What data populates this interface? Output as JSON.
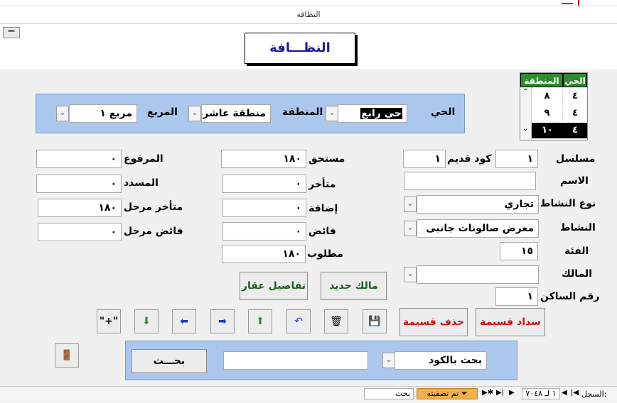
{
  "window": {
    "title": "النظافة"
  },
  "form": {
    "title": "النظـــافة"
  },
  "filter": {
    "hay_label": "الحي",
    "hay_value": "حي رابع",
    "region_label": "المنطقة",
    "region_value": "منطقة عاشرة",
    "block_label": "المربع",
    "block_value": "مربع ١"
  },
  "mini_list": {
    "headers": [
      "الحي",
      "المنطقة"
    ],
    "rows": [
      {
        "hay": "٤",
        "region": "٨"
      },
      {
        "hay": "٤",
        "region": "٩"
      },
      {
        "hay": "٤",
        "region": "١٠"
      }
    ]
  },
  "record": {
    "serial_label": "مسلسل",
    "serial_value": "١",
    "old_code_label": "كود قديم",
    "old_code_value": "١",
    "name_label": "الاسم",
    "name_value": "",
    "activity_type_label": "نوع النشاط",
    "activity_type_value": "تجاري",
    "activity_label": "النشاط",
    "activity_value": "معرض صالونات جانبى",
    "category_label": "الفئة",
    "category_value": "١٥",
    "owner_label": "المالك",
    "owner_value": "",
    "tenant_no_label": "رقم الساكن",
    "tenant_no_value": "١"
  },
  "amounts": {
    "due_label": "مستحق",
    "due_value": "١٨٠",
    "late_label": "متأخر",
    "late_value": "٠",
    "addition_label": "إضافة",
    "addition_value": "٠",
    "surplus_label": "فائض",
    "surplus_value": "٠",
    "required_label": "مطلوب",
    "required_value": "١٨٠",
    "raised_label": "المرفوع",
    "raised_value": "٠",
    "paid_label": "المسدد",
    "paid_value": "٠",
    "carried_late_label": "متأخر مرحل",
    "carried_late_value": "١٨٠",
    "carried_surplus_label": "فائض مرحل",
    "carried_surplus_value": "٠"
  },
  "buttons": {
    "new_owner": "مالك جديد",
    "property_details": "تفاصيل عقار",
    "pay_voucher": "سداد قسيمة",
    "delete_voucher": "حذف قسيمة",
    "search": "بحـــث",
    "add_record": "\"+\""
  },
  "bottom_search": {
    "mode_value": "بحث بالكود",
    "query_value": ""
  },
  "status_bar": {
    "record_label": "السجل:",
    "record_position": "١ لـ ٧٠٤٨",
    "filter_label": "تم تصفيته",
    "search_label": "بحث"
  },
  "colors": {
    "panel_blue": "#abc7ee",
    "title_blue": "#1a1aa6",
    "button_green": "#1e5e1e",
    "button_red": "#cc1111",
    "list_header_green": "#2e8b2e",
    "filter_badge": "#f0b04a"
  },
  "icons": {
    "first": "first-record-icon",
    "prev": "prev-record-icon",
    "next": "next-record-icon",
    "last": "last-record-icon",
    "new": "new-record-icon",
    "exit": "exit-door-icon",
    "save": "save-disk-icon",
    "trash": "trash-icon",
    "undo": "undo-icon"
  }
}
